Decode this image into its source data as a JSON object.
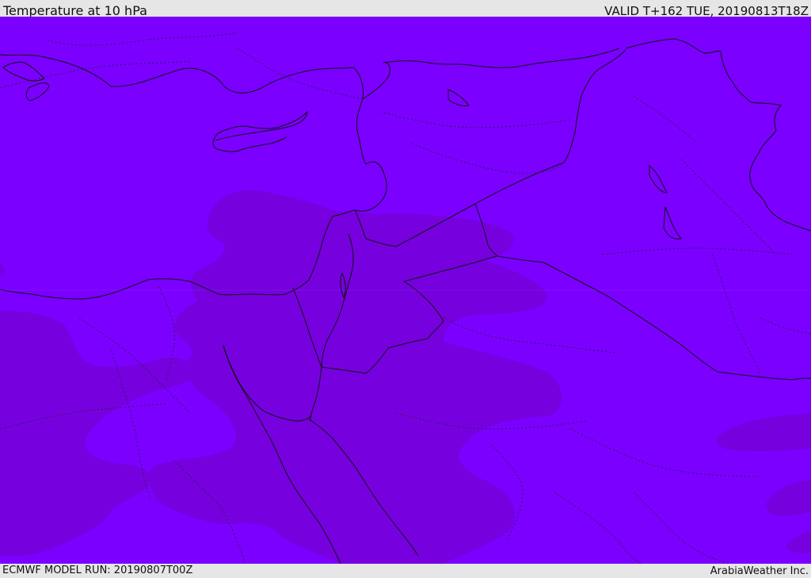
{
  "header": {
    "title": "Temperature at 10 hPa",
    "valid": "VALID T+162 TUE, 20190813T18Z"
  },
  "footer": {
    "model_run": "ECMWF MODEL RUN: 20190807T00Z",
    "credit": "ArabiaWeather Inc."
  },
  "map": {
    "field_colors": {
      "background": "#7b00ff",
      "warm_patch": "#7600de"
    },
    "region": "Eastern Mediterranean / Middle East"
  }
}
